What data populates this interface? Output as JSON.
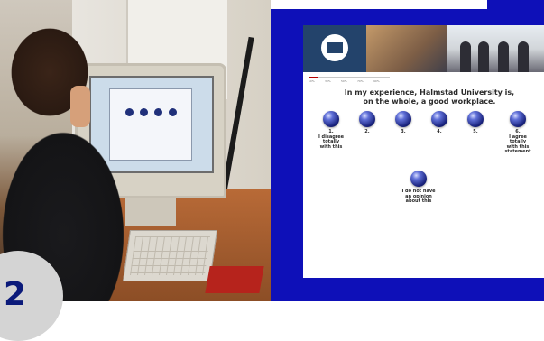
{
  "badge": {
    "text": "2"
  },
  "survey": {
    "question_line1": "In my experience, Halmstad University is,",
    "question_line2": "on the whole, a good workplace.",
    "progress_fraction": 0.12,
    "progress_ticks": [
      "10%",
      "30%",
      "50%",
      "70%",
      "90%"
    ],
    "options": [
      {
        "label": "1.\nI disagree\ntotally\nwith this"
      },
      {
        "label": "2."
      },
      {
        "label": "3."
      },
      {
        "label": "4."
      },
      {
        "label": "5."
      },
      {
        "label": "6.\nI agree\ntotally\nwith this\nstatement"
      }
    ],
    "no_opinion": {
      "label": "I do not have\nan opinion\nabout this"
    }
  },
  "colors": {
    "panel_blue": "#0e10b8",
    "button_navy": "#17207a",
    "progress_red": "#b50000"
  }
}
